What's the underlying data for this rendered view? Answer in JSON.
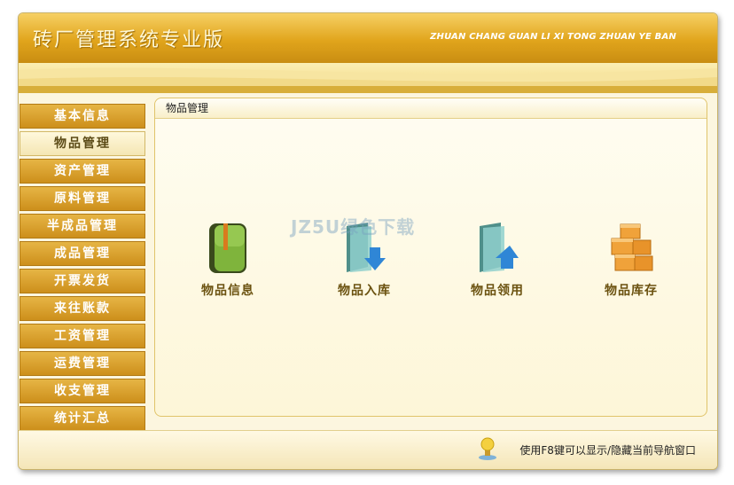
{
  "app": {
    "title": "砖厂管理系统专业版",
    "subtitle": "ZHUAN CHANG GUAN LI XI TONG ZHUAN YE BAN"
  },
  "sidebar": {
    "items": [
      {
        "label": "基本信息"
      },
      {
        "label": "物品管理",
        "active": true
      },
      {
        "label": "资产管理"
      },
      {
        "label": "原料管理"
      },
      {
        "label": "半成品管理"
      },
      {
        "label": "成品管理"
      },
      {
        "label": "开票发货"
      },
      {
        "label": "来往账款"
      },
      {
        "label": "工资管理"
      },
      {
        "label": "运费管理"
      },
      {
        "label": "收支管理"
      },
      {
        "label": "统计汇总"
      }
    ]
  },
  "panel": {
    "title": "物品管理",
    "tiles": [
      {
        "label": "物品信息",
        "icon": "green-book-icon"
      },
      {
        "label": "物品入库",
        "icon": "folder-down-arrow-icon"
      },
      {
        "label": "物品领用",
        "icon": "folder-up-arrow-icon"
      },
      {
        "label": "物品库存",
        "icon": "stacked-boxes-icon"
      }
    ]
  },
  "watermark": "JZ5U绿色下载",
  "footer": {
    "hint": "使用F8键可以显示/隐藏当前导航窗口",
    "icon": "lamp-hint-icon"
  },
  "colors": {
    "header": "#e1a51c",
    "nav": "#cd8f1b",
    "nav_active": "#fff8dc",
    "tile_label": "#6b5210",
    "panel_bg": "#fdf6d8"
  }
}
